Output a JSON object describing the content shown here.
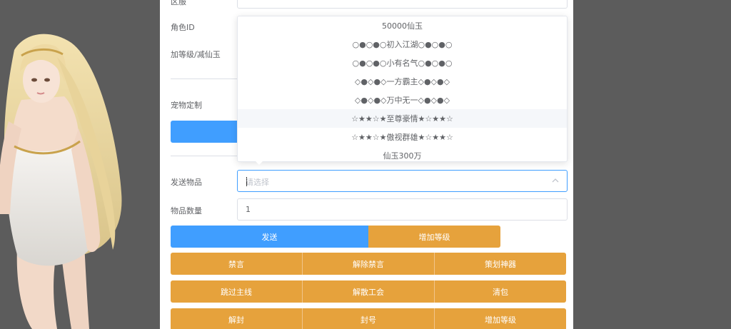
{
  "form": {
    "top_label": "区服",
    "role_id_label": "角色ID",
    "level_label": "加等级/减仙玉",
    "pet_label": "宠物定制",
    "send_item_label": "发送物品",
    "send_item_placeholder": "请选择",
    "item_qty_label": "物品数量",
    "item_qty_value": "1"
  },
  "dropdown": {
    "items": [
      "50000仙玉",
      "○●○●○初入江湖○●○●○",
      "○●○●○小有名气○●○●○",
      "◇●◇●◇一方霸主◇●◇●◇",
      "◇●◇●◇万中无一◇●◇●◇",
      "☆★★☆★至尊豪情★☆★★☆",
      "☆★★☆★傲视群雄★☆★★☆",
      "仙玉300万"
    ]
  },
  "buttons": {
    "send": "发送",
    "add_level": "增加等级",
    "row1": [
      "禁言",
      "解除禁言",
      "策划神器"
    ],
    "row2": [
      "跳过主线",
      "解散工会",
      "清包"
    ],
    "row3": [
      "解封",
      "封号",
      "增加等级"
    ]
  },
  "colors": {
    "primary": "#409eff",
    "warning": "#e6a23c",
    "backdrop": "#5c5c5c"
  }
}
